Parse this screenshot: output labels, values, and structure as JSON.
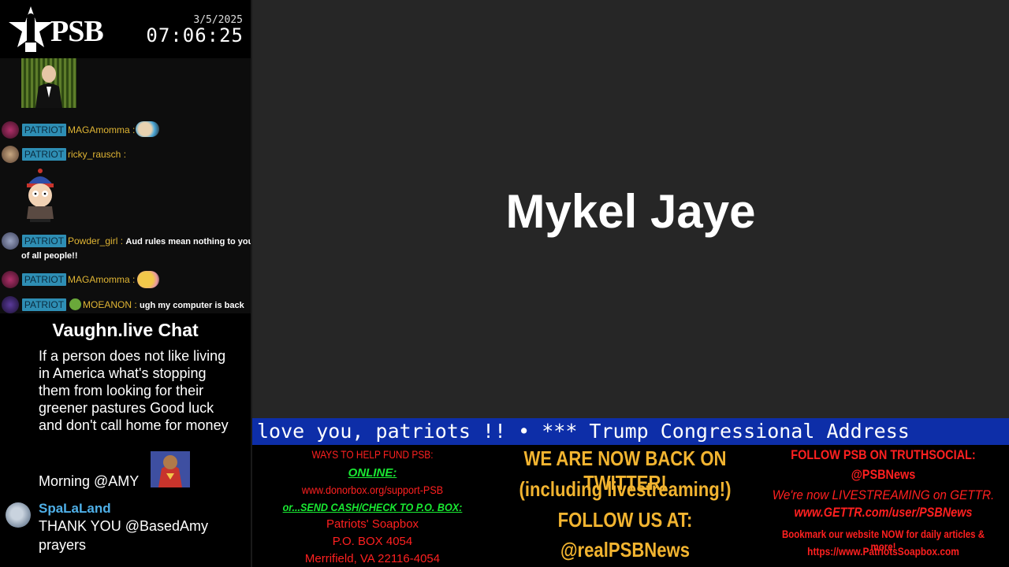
{
  "header": {
    "logo_text": "PSB",
    "date": "3/5/2025",
    "time": "07:06:25"
  },
  "chat_top": {
    "messages": [
      {
        "badge": "PATRIOT",
        "user": "MAGAmomma",
        "sep": ":",
        "text": ""
      },
      {
        "badge": "PATRIOT",
        "user": "ricky_rausch",
        "sep": ":",
        "text": ""
      },
      {
        "badge": "PATRIOT",
        "user": "Powder_girl",
        "sep": ":",
        "text": "Aud rules mean nothing to you",
        "text2": "of all people!!"
      },
      {
        "badge": "PATRIOT",
        "user": "MAGAmomma",
        "sep": ":",
        "text": ""
      },
      {
        "badge": "PATRIOT",
        "user": "MOEANON",
        "sep": ":",
        "text": "ugh my computer is back"
      }
    ]
  },
  "vaughn": {
    "title": "Vaughn.live Chat",
    "msg1": "If a person does not like living in America what's stopping them from looking for their greener pastures Good luck and don't call home for money",
    "msg2": "Morning @AMY",
    "user": "SpaLaLand",
    "msg3": "THANK YOU @BasedAmy prayers"
  },
  "stage": {
    "speaker": "Mykel Jaye"
  },
  "ticker": {
    "text": "love you, patriots !!   •   *** Trump Congressional Address"
  },
  "fund": {
    "head": "WAYS TO HELP FUND PSB:",
    "online": "ONLINE:",
    "url": "www.donorbox.org/support-PSB",
    "mail": "or...SEND CASH/CHECK TO P.O. BOX:",
    "name": "Patriots' Soapbox",
    "box": "P.O. BOX 4054",
    "city": "Merrifield, VA 22116-4054"
  },
  "twitter": {
    "line1": "WE ARE NOW BACK ON TWITTER!",
    "line2": "(including livestreaming!)",
    "line3": "FOLLOW US AT:",
    "line4": "@realPSBNews"
  },
  "truth": {
    "head": "FOLLOW PSB ON TRUTHSOCIAL:",
    "handle": "@PSBNews",
    "gettr1": "We're now LIVESTREAMING on GETTR.",
    "gettr2": "www.GETTR.com/user/PSBNews",
    "bookmark": "Bookmark our website NOW for daily articles & more!",
    "url": "https://www.PatriotsSoapbox.com"
  },
  "colors": {
    "badge": "#2e8eb4",
    "username": "#e0b534",
    "ticker_bg": "#0d2ea8",
    "stage_bg": "#262626",
    "red": "#ff2020",
    "green": "#19e832",
    "orange": "#f2b430"
  }
}
